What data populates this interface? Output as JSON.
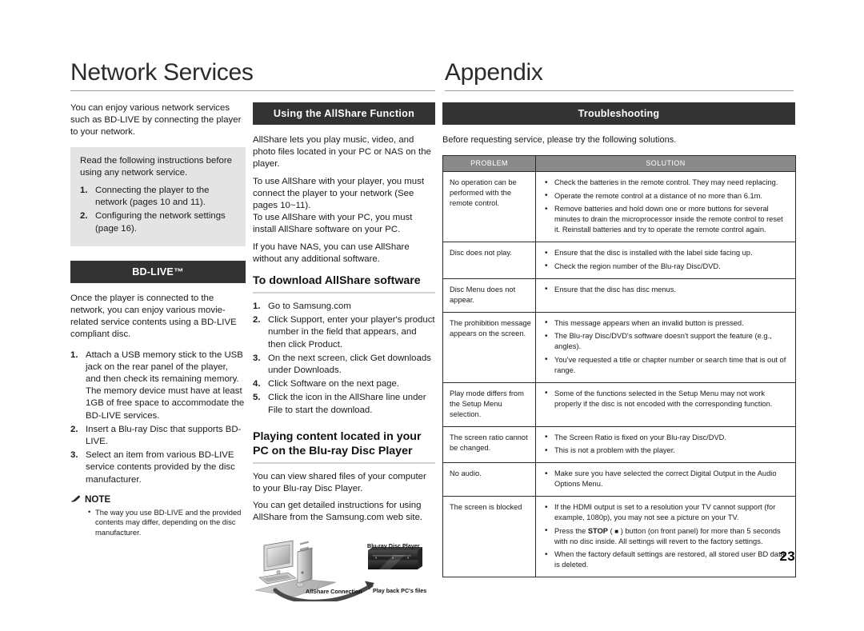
{
  "page": {
    "number": "23",
    "left_title": "Network Services",
    "right_title": "Appendix"
  },
  "network_services": {
    "intro": "You can enjoy various network services such as BD-LIVE by connecting the player to your network.",
    "gray_box": {
      "lead": "Read the following instructions before using any network service.",
      "items": [
        {
          "num": "1.",
          "text": "Connecting the player to the network (pages 10 and 11)."
        },
        {
          "num": "2.",
          "text": "Configuring the network settings (page 16)."
        }
      ]
    },
    "bdlive": {
      "header": "BD-LIVE™",
      "intro": "Once the player is connected to the network, you can enjoy various movie-related service contents using a BD-LIVE compliant disc.",
      "items": [
        {
          "num": "1.",
          "text": "Attach a USB memory stick to the USB jack on the rear panel of the player, and then check its remaining memory. The memory device must have at least 1GB of free space to accommodate the BD-LIVE services."
        },
        {
          "num": "2.",
          "text": "Insert a Blu-ray Disc that supports BD-LIVE."
        },
        {
          "num": "3.",
          "text": "Select an item from various BD-LIVE service contents provided by the disc manufacturer."
        }
      ],
      "note_label": "NOTE",
      "notes": [
        "The way you use BD-LIVE and the provided contents may differ, depending on the disc manufacturer."
      ]
    }
  },
  "allshare": {
    "header": "Using the AllShare Function",
    "paragraphs": [
      "AllShare lets you play music, video, and photo files located in your PC or NAS on the player.",
      "To use AllShare with your player, you must connect the player to your network (See pages 10~11).\nTo use AllShare with your PC, you must install AllShare software on your PC.",
      "If you have NAS, you can use AllShare without any additional software."
    ],
    "download": {
      "heading": "To download AllShare software",
      "items": [
        {
          "num": "1.",
          "text": "Go to Samsung.com"
        },
        {
          "num": "2.",
          "text": "Click Support, enter your player's product number in the field that appears, and then click Product."
        },
        {
          "num": "3.",
          "text": "On the next screen, click Get downloads under Downloads."
        },
        {
          "num": "4.",
          "text": "Click Software on the next page."
        },
        {
          "num": "5.",
          "text": "Click the icon in the AllShare line under File to start the download."
        }
      ]
    },
    "playing": {
      "heading": "Playing content located in your PC on the Blu-ray Disc Player",
      "paragraphs": [
        "You can view shared files of your computer to your Blu-ray Disc Player.",
        "You can get detailed instructions for using AllShare from the Samsung.com web site."
      ]
    },
    "diagram": {
      "player_label": "Blu-ray Disc Player",
      "connection_label": "AllShare Connection",
      "playback_label": "Play back PC's files"
    }
  },
  "appendix": {
    "troubleshooting_header": "Troubleshooting",
    "intro": "Before requesting service, please try the following solutions.",
    "table": {
      "headers": [
        "PROBLEM",
        "SOLUTION"
      ],
      "rows": [
        {
          "problem": "No operation can be performed with the remote control.",
          "solutions": [
            "Check the batteries in the remote control. They may need replacing.",
            "Operate the remote control at a distance of no more than 6.1m.",
            "Remove batteries and hold down one or more buttons for several minutes to drain the microprocessor inside the remote control to reset it. Reinstall batteries and try to operate the remote control again."
          ]
        },
        {
          "problem": "Disc does not play.",
          "solutions": [
            "Ensure that the disc is installed with the label side facing up.",
            "Check the region number of the Blu-ray Disc/DVD."
          ]
        },
        {
          "problem": "Disc Menu does not appear.",
          "solutions": [
            "Ensure that the disc has disc menus."
          ]
        },
        {
          "problem": "The prohibition message appears on the screen.",
          "solutions": [
            "This message appears when an invalid button is pressed.",
            "The Blu-ray Disc/DVD's software doesn't support the feature (e.g., angles).",
            "You've requested a title or chapter number or search time that is out of range."
          ]
        },
        {
          "problem": "Play mode differs from the Setup Menu selection.",
          "solutions": [
            "Some of the functions selected in the Setup Menu may not work properly if the disc is not encoded with the corresponding function."
          ]
        },
        {
          "problem": "The screen ratio cannot be changed.",
          "solutions": [
            "The Screen Ratio is fixed on your Blu-ray Disc/DVD.",
            "This is not a problem with the player."
          ]
        },
        {
          "problem": "No audio.",
          "solutions": [
            "Make sure you have selected the correct Digital Output in the Audio Options Menu."
          ]
        },
        {
          "problem": "The screen is blocked",
          "solutions": [
            "If the HDMI output is set to a resolution your TV cannot support (for example, 1080p), you may not see a picture on your TV.",
            "Press the STOP ( ■ ) button (on front panel) for more than 5 seconds with no disc inside. All settings will revert to the factory settings.",
            "When the factory default settings are restored, all stored user BD data is deleted."
          ]
        }
      ]
    }
  },
  "colors": {
    "section_bar": "#333333",
    "table_header": "#8a8a8a",
    "gray_box": "#e4e4e4",
    "rule": "#9a9a9a"
  }
}
